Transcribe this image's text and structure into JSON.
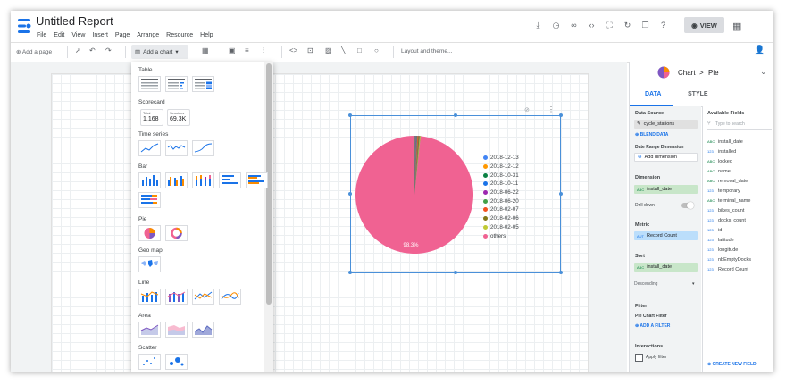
{
  "app": {
    "title": "Untitled Report"
  },
  "menus": [
    "File",
    "Edit",
    "View",
    "Insert",
    "Page",
    "Arrange",
    "Resource",
    "Help"
  ],
  "header": {
    "view_label": "VIEW"
  },
  "toolbar": {
    "add_page": "Add a page",
    "add_chart": "Add a chart",
    "layout_theme": "Layout and theme..."
  },
  "chart_menu": {
    "table": "Table",
    "scorecard": "Scorecard",
    "scorecard_cards": [
      {
        "label": "Total",
        "value": "1,168"
      },
      {
        "label": "Sessions",
        "value": "69.3K"
      }
    ],
    "time_series": "Time series",
    "bar": "Bar",
    "pie": "Pie",
    "geo_map": "Geo map",
    "line": "Line",
    "area": "Area",
    "scatter": "Scatter"
  },
  "chart_data": {
    "type": "pie",
    "categories": [
      "2018-12-13",
      "2018-12-12",
      "2018-10-31",
      "2018-10-11",
      "2018-06-22",
      "2018-06-20",
      "2018-02-07",
      "2018-02-06",
      "2018-02-05",
      "others"
    ],
    "values": [
      0.1,
      0.1,
      0.1,
      0.1,
      0.2,
      0.2,
      0.3,
      0.3,
      0.3,
      98.3
    ],
    "slice_label": "98.3%",
    "colors": [
      "#4285f4",
      "#ff9800",
      "#0b8043",
      "#1a73e8",
      "#9c27b0",
      "#43a047",
      "#f4511e",
      "#827717",
      "#c0ca33",
      "#f06292"
    ]
  },
  "panel": {
    "breadcrumb_chart": "Chart",
    "breadcrumb_sep": ">",
    "breadcrumb_type": "Pie",
    "tab_data": "DATA",
    "tab_style": "STYLE",
    "data_source_label": "Data Source",
    "data_source": "cycle_stations",
    "blend_data": "BLEND DATA",
    "date_range_label": "Date Range Dimension",
    "add_dimension": "Add dimension",
    "dimension_label": "Dimension",
    "dimension": "install_date",
    "drill_down": "Drill down",
    "metric_label": "Metric",
    "metric": "Record Count",
    "sort_label": "Sort",
    "sort": "install_date",
    "sort_order": "Descending",
    "filter_label": "Filter",
    "pie_chart_filter": "Pie Chart Filter",
    "add_filter": "ADD A FILTER",
    "interactions": "Interactions",
    "apply_filter": "Apply filter",
    "available_fields": "Available Fields",
    "search_placeholder": "Type to search",
    "fields": [
      {
        "type": "ABC",
        "name": "install_date"
      },
      {
        "type": "123",
        "name": "installed"
      },
      {
        "type": "ABC",
        "name": "locked"
      },
      {
        "type": "ABC",
        "name": "name"
      },
      {
        "type": "ABC",
        "name": "removal_date"
      },
      {
        "type": "123",
        "name": "temporary"
      },
      {
        "type": "ABC",
        "name": "terminal_name"
      },
      {
        "type": "123",
        "name": "bikes_count"
      },
      {
        "type": "123",
        "name": "docks_count"
      },
      {
        "type": "123",
        "name": "id"
      },
      {
        "type": "123",
        "name": "latitude"
      },
      {
        "type": "123",
        "name": "longitude"
      },
      {
        "type": "123",
        "name": "nbEmptyDocks"
      },
      {
        "type": "123",
        "name": "Record Count"
      }
    ],
    "create_field": "CREATE NEW FIELD"
  }
}
